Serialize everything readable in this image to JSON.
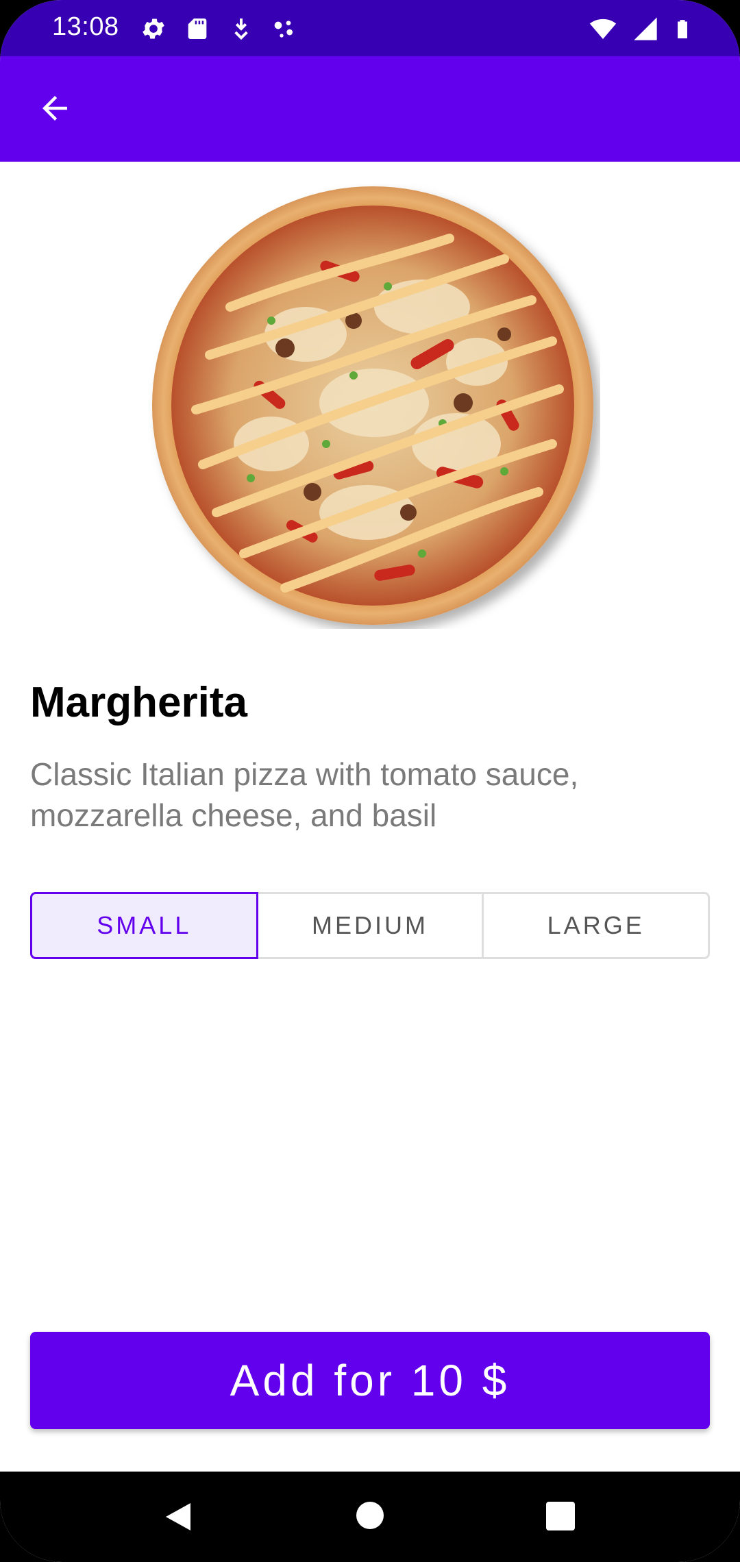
{
  "status_bar": {
    "time": "13:08",
    "left_icons": [
      "gear-icon",
      "sd-card-icon",
      "download-icon",
      "assistant-dots-icon"
    ],
    "right_icons": [
      "wifi-icon",
      "cell-signal-icon",
      "battery-icon"
    ]
  },
  "app_bar": {
    "back_icon": "arrow-back-icon",
    "color": "#6200ee"
  },
  "product": {
    "image": "pizza-image",
    "title": "Margherita",
    "description": "Classic Italian pizza with tomato sauce, mozzarella cheese, and basil"
  },
  "sizes": {
    "options": [
      "SMALL",
      "MEDIUM",
      "LARGE"
    ],
    "selected": "SMALL"
  },
  "cta": {
    "label": "Add for 10 $"
  },
  "nav_bar": {
    "icons": [
      "nav-back-icon",
      "nav-home-icon",
      "nav-recents-icon"
    ]
  },
  "colors": {
    "primary": "#6200ee",
    "primary_dark": "#3700b3",
    "selected_bg": "#f1ecfd",
    "text_secondary": "#7a7a7a"
  }
}
